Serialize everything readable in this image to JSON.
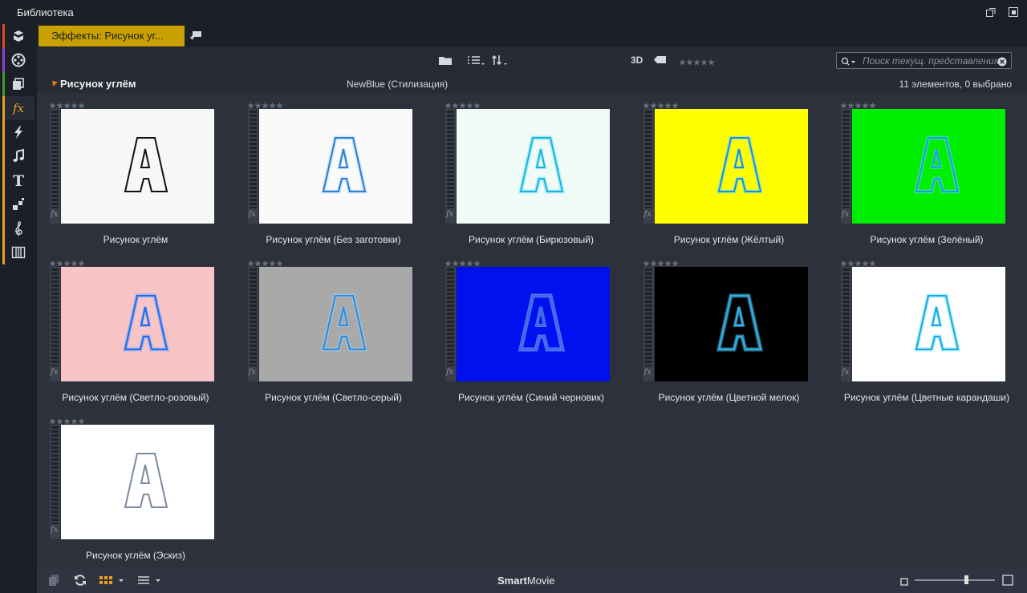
{
  "window": {
    "title": "Библиотека"
  },
  "sidebar": {
    "items": [
      {
        "name": "project-bin-icon",
        "stripe": "#e8442a"
      },
      {
        "name": "film-reel-icon",
        "stripe": "#8a3fd0"
      },
      {
        "name": "pages-icon",
        "stripe": "#3aa030"
      },
      {
        "name": "fx-icon",
        "stripe": "#e8a020",
        "active": true
      },
      {
        "name": "lightning-icon",
        "stripe": "#e8a020"
      },
      {
        "name": "music-note-icon",
        "stripe": "#e8a020"
      },
      {
        "name": "title-t-icon",
        "stripe": "#e8a020"
      },
      {
        "name": "blocks-icon",
        "stripe": "#e8a020"
      },
      {
        "name": "treble-clef-icon",
        "stripe": "#e8a020"
      },
      {
        "name": "piano-keys-icon",
        "stripe": "#e8a020"
      }
    ]
  },
  "tabs": {
    "active_label": "Эффекты: Рисунок уг...",
    "accent": "#c8a000"
  },
  "toolbar": {
    "label_3d": "3D",
    "search_placeholder": "Поиск текущ. представления"
  },
  "group": {
    "title": "Рисунок углём",
    "subtitle": "NewBlue (Стилизация)",
    "count": "11 элементов, 0 выбрано"
  },
  "items": [
    {
      "label": "Рисунок углём",
      "bg": "#f7f7f7",
      "stroke": "#111111",
      "glow": "none"
    },
    {
      "label": "Рисунок углём (Без заготовки)",
      "bg": "#fafafa",
      "stroke": "#2b7fd0",
      "glow": "faint"
    },
    {
      "label": "Рисунок углём (Бирюзовый)",
      "bg": "#f0faf6",
      "stroke": "#1ab4e0",
      "glow": "cyan"
    },
    {
      "label": "Рисунок углём (Жёлтый)",
      "bg": "#ffff00",
      "stroke": "#1a8ce0",
      "glow": "cyan"
    },
    {
      "label": "Рисунок углём (Зелёный)",
      "bg": "#00ee00",
      "stroke": "#1a9ce8",
      "glow": "cyan"
    },
    {
      "label": "Рисунок углём (Светло-розовый)",
      "bg": "#f8c4c6",
      "stroke": "#1a6cf0",
      "glow": "blue"
    },
    {
      "label": "Рисунок углём (Светло-серый)",
      "bg": "#a9a9a9",
      "stroke": "#2a8ce0",
      "glow": "faint"
    },
    {
      "label": "Рисунок углём (Синий черновик)",
      "bg": "#0010ee",
      "stroke": "#3a6ae0",
      "glow": "faint"
    },
    {
      "label": "Рисунок углём (Цветной мелок)",
      "bg": "#000000",
      "stroke": "#2ab0f0",
      "glow": "cyan"
    },
    {
      "label": "Рисунок углём (Цветные карандаши)",
      "bg": "#ffffff",
      "stroke": "#1aa8e0",
      "glow": "cyan"
    },
    {
      "label": "Рисунок углём (Эскиз)",
      "bg": "#ffffff",
      "stroke": "#7a8aa0",
      "glow": "none"
    }
  ],
  "bottombar": {
    "brand_bold": "Smart",
    "brand_rest": "Movie",
    "zoom_level": 0.65
  }
}
